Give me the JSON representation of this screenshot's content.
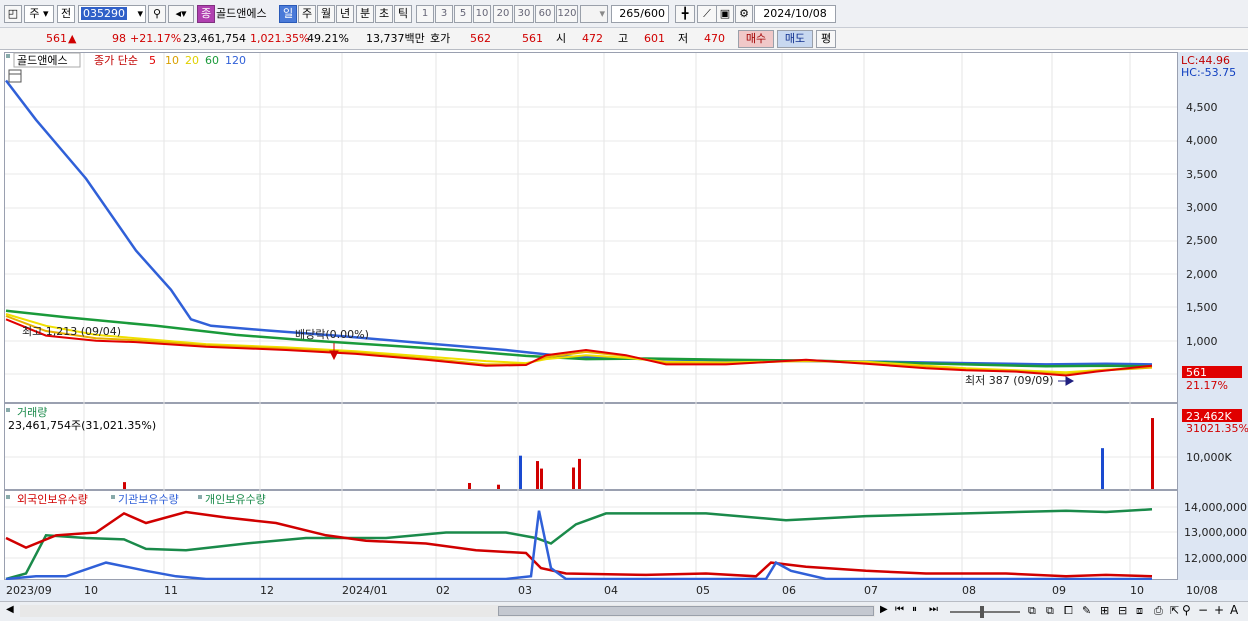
{
  "toolbar": {
    "market_label": "주",
    "prev_label": "전",
    "code": "035290",
    "stock_badge": "종",
    "stock_name": "골드앤에스",
    "period_buttons": [
      "일",
      "주",
      "월",
      "년",
      "분",
      "초",
      "틱"
    ],
    "number_buttons": [
      "1",
      "3",
      "5",
      "10",
      "20",
      "30",
      "60",
      "120"
    ],
    "count": "265",
    "count_total": "/600",
    "date": "2024/10/08"
  },
  "quote": {
    "price": "561",
    "change": "98",
    "change_rate": "+21.17%",
    "volume": "23,461,754",
    "volume_rate": "1,021.35%",
    "turnover": "49.21%",
    "amount": "13,737백만",
    "ask_label": "호가",
    "ask": "562",
    "bid": "561",
    "open_label": "시",
    "open": "472",
    "high_label": "고",
    "high": "601",
    "low_label": "저",
    "low": "470",
    "buy_label": "매수",
    "sell_label": "매도",
    "eval_label": "평"
  },
  "price_panel": {
    "name": "골드앤에스",
    "ma_label": "종가 단순",
    "ma_periods": [
      "5",
      "10",
      "20",
      "60",
      "120"
    ],
    "ma_colors": [
      "#e00000",
      "#e8b000",
      "#f0e000",
      "#1a9a3a",
      "#3060d8"
    ],
    "lc": "LC:44.96",
    "hc": "HC:-53.75",
    "y_ticks": [
      "4,500",
      "4,000",
      "3,500",
      "3,000",
      "2,500",
      "2,000",
      "1,500",
      "1,000"
    ],
    "max_label": "최고 1,213 (09/04)",
    "min_label": "최저 387 (09/09)",
    "dividend_label": "배당락(0.00%)",
    "current_price": "561",
    "current_rate": "21.17%"
  },
  "volume_panel": {
    "title": "거래량",
    "subtitle": "23,461,754주(31,021.35%)",
    "y_tick": "10,000K",
    "current": "23,462K",
    "current_rate": "31021.35%"
  },
  "holding_panel": {
    "labels": [
      "외국인보유수량",
      "기관보유수량",
      "개인보유수량"
    ],
    "colors": [
      "#d00000",
      "#3060d8",
      "#1a8a4a"
    ],
    "y_ticks": [
      "14,000,000",
      "13,000,000",
      "12,000,000"
    ]
  },
  "x_axis": {
    "labels": [
      "2023/09",
      "10",
      "11",
      "12",
      "2024/01",
      "02",
      "03",
      "04",
      "05",
      "06",
      "07",
      "08",
      "09",
      "10"
    ],
    "current": "10/08"
  },
  "chart_data": {
    "type": "line",
    "price": {
      "ylim": [
        0,
        5000
      ],
      "ma120": [
        [
          0,
          4900
        ],
        [
          30,
          4300
        ],
        [
          80,
          3400
        ],
        [
          130,
          2300
        ],
        [
          165,
          1700
        ],
        [
          185,
          1250
        ],
        [
          205,
          1150
        ],
        [
          260,
          1080
        ],
        [
          330,
          1000
        ],
        [
          420,
          880
        ],
        [
          500,
          780
        ],
        [
          560,
          680
        ],
        [
          640,
          640
        ],
        [
          720,
          620
        ],
        [
          800,
          610
        ],
        [
          880,
          600
        ],
        [
          960,
          580
        ],
        [
          1040,
          560
        ],
        [
          1100,
          570
        ],
        [
          1146,
          560
        ]
      ],
      "ma60": [
        [
          0,
          1380
        ],
        [
          60,
          1280
        ],
        [
          150,
          1150
        ],
        [
          230,
          1010
        ],
        [
          300,
          930
        ],
        [
          380,
          850
        ],
        [
          450,
          780
        ],
        [
          520,
          690
        ],
        [
          580,
          640
        ],
        [
          640,
          650
        ],
        [
          720,
          630
        ],
        [
          800,
          620
        ],
        [
          880,
          590
        ],
        [
          960,
          560
        ],
        [
          1040,
          530
        ],
        [
          1100,
          540
        ],
        [
          1146,
          530
        ]
      ],
      "ma20": [
        [
          0,
          1330
        ],
        [
          40,
          1150
        ],
        [
          90,
          1010
        ],
        [
          130,
          960
        ],
        [
          200,
          870
        ],
        [
          280,
          820
        ],
        [
          350,
          760
        ],
        [
          420,
          680
        ],
        [
          480,
          610
        ],
        [
          520,
          580
        ],
        [
          540,
          640
        ],
        [
          580,
          700
        ],
        [
          620,
          660
        ],
        [
          660,
          600
        ],
        [
          720,
          590
        ],
        [
          800,
          610
        ],
        [
          860,
          600
        ],
        [
          920,
          540
        ],
        [
          960,
          500
        ],
        [
          1010,
          470
        ],
        [
          1060,
          440
        ],
        [
          1100,
          480
        ],
        [
          1146,
          520
        ]
      ],
      "ma10": [
        [
          0,
          1300
        ],
        [
          40,
          1070
        ],
        [
          90,
          960
        ],
        [
          130,
          930
        ],
        [
          200,
          850
        ],
        [
          280,
          800
        ],
        [
          350,
          740
        ],
        [
          420,
          650
        ],
        [
          480,
          560
        ],
        [
          520,
          560
        ],
        [
          540,
          670
        ],
        [
          580,
          750
        ],
        [
          620,
          690
        ],
        [
          660,
          580
        ],
        [
          720,
          570
        ],
        [
          800,
          620
        ],
        [
          860,
          580
        ],
        [
          920,
          520
        ],
        [
          960,
          480
        ],
        [
          1010,
          460
        ],
        [
          1060,
          410
        ],
        [
          1090,
          460
        ],
        [
          1146,
          510
        ]
      ],
      "ma5": [
        [
          0,
          1250
        ],
        [
          40,
          1000
        ],
        [
          90,
          920
        ],
        [
          130,
          900
        ],
        [
          200,
          830
        ],
        [
          280,
          780
        ],
        [
          350,
          720
        ],
        [
          420,
          630
        ],
        [
          480,
          540
        ],
        [
          520,
          550
        ],
        [
          540,
          700
        ],
        [
          580,
          780
        ],
        [
          620,
          700
        ],
        [
          660,
          560
        ],
        [
          720,
          560
        ],
        [
          800,
          630
        ],
        [
          860,
          570
        ],
        [
          920,
          500
        ],
        [
          960,
          470
        ],
        [
          1010,
          450
        ],
        [
          1060,
          390
        ],
        [
          1090,
          450
        ],
        [
          1146,
          540
        ]
      ]
    },
    "volume_spikes": [
      [
        118,
        3.2
      ],
      [
        463,
        2.8
      ],
      [
        492,
        2.0
      ],
      [
        514,
        15.5
      ],
      [
        531,
        13.0
      ],
      [
        535,
        9.5
      ],
      [
        567,
        10.0
      ],
      [
        573,
        14.0
      ],
      [
        1096,
        19.0
      ],
      [
        1146,
        33.0
      ]
    ],
    "holdings": {
      "ylim": [
        11600000,
        14600000
      ],
      "foreign": [
        [
          0,
          13100000
        ],
        [
          20,
          12750000
        ],
        [
          50,
          13200000
        ],
        [
          90,
          13300000
        ],
        [
          118,
          14000000
        ],
        [
          140,
          13650000
        ],
        [
          180,
          14050000
        ],
        [
          220,
          13850000
        ],
        [
          270,
          13650000
        ],
        [
          320,
          13200000
        ],
        [
          360,
          13000000
        ],
        [
          420,
          12900000
        ],
        [
          470,
          12650000
        ],
        [
          520,
          12550000
        ],
        [
          535,
          12000000
        ],
        [
          560,
          11800000
        ],
        [
          640,
          11750000
        ],
        [
          700,
          11800000
        ],
        [
          750,
          11700000
        ],
        [
          765,
          12200000
        ],
        [
          800,
          12050000
        ],
        [
          860,
          11900000
        ],
        [
          920,
          11800000
        ],
        [
          1000,
          11800000
        ],
        [
          1060,
          11700000
        ],
        [
          1100,
          11750000
        ],
        [
          1146,
          11700000
        ]
      ],
      "institution": [
        [
          0,
          11600000
        ],
        [
          30,
          11700000
        ],
        [
          60,
          11700000
        ],
        [
          100,
          12200000
        ],
        [
          140,
          11900000
        ],
        [
          170,
          11700000
        ],
        [
          200,
          11600000
        ],
        [
          500,
          11600000
        ],
        [
          525,
          11700000
        ],
        [
          533,
          14100000
        ],
        [
          545,
          12000000
        ],
        [
          560,
          11600000
        ],
        [
          700,
          11600000
        ],
        [
          760,
          11600000
        ],
        [
          770,
          12200000
        ],
        [
          785,
          11900000
        ],
        [
          820,
          11600000
        ],
        [
          1146,
          11600000
        ]
      ],
      "individual": [
        [
          0,
          11600000
        ],
        [
          20,
          11800000
        ],
        [
          40,
          13200000
        ],
        [
          80,
          13100000
        ],
        [
          118,
          13050000
        ],
        [
          140,
          12700000
        ],
        [
          180,
          12650000
        ],
        [
          240,
          12900000
        ],
        [
          300,
          13100000
        ],
        [
          380,
          13100000
        ],
        [
          440,
          13300000
        ],
        [
          500,
          13300000
        ],
        [
          530,
          13100000
        ],
        [
          545,
          12900000
        ],
        [
          570,
          13600000
        ],
        [
          600,
          14000000
        ],
        [
          700,
          14000000
        ],
        [
          780,
          13750000
        ],
        [
          860,
          13900000
        ],
        [
          960,
          14000000
        ],
        [
          1060,
          14100000
        ],
        [
          1100,
          14050000
        ],
        [
          1146,
          14150000
        ]
      ]
    }
  }
}
